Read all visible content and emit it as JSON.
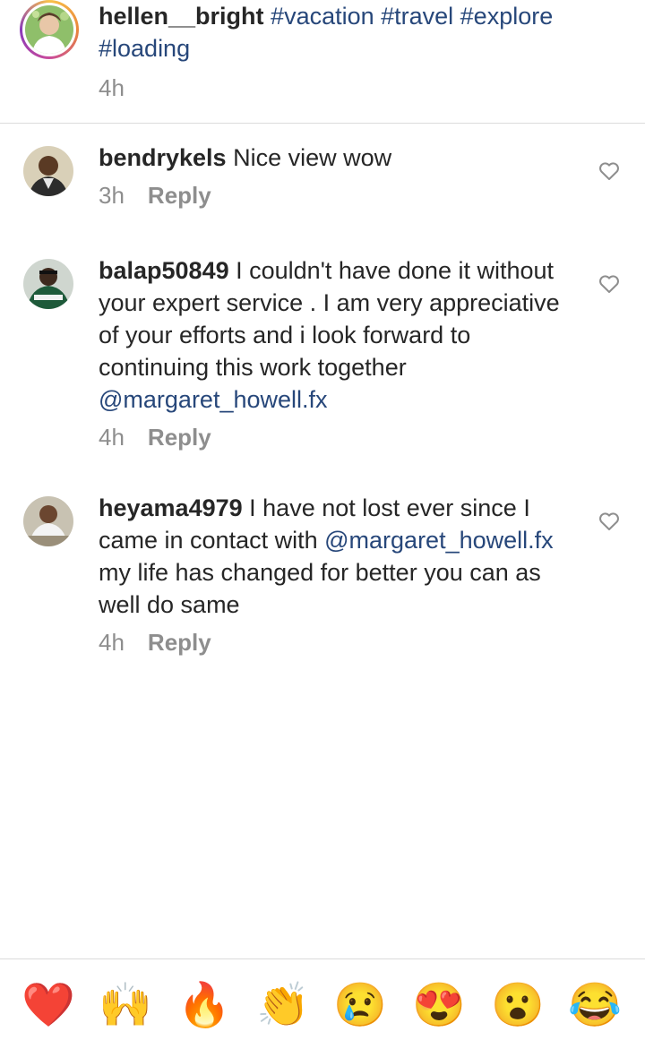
{
  "caption": {
    "username": "hellen__bright",
    "hashtags": "#vacation #travel #explore #loading",
    "time": "4h"
  },
  "comments": [
    {
      "username": "bendrykels",
      "text": "Nice view wow",
      "time": "3h",
      "reply_label": "Reply"
    },
    {
      "username": "balap50849",
      "text": "I couldn't have done it without your expert service . I am very appreciative of your efforts and i look forward to continuing this work together",
      "mention": "@margaret_howell.fx",
      "time": "4h",
      "reply_label": "Reply"
    },
    {
      "username": "heyama4979",
      "text_before": "I have not lost ever since I came in contact with",
      "mention": "@margaret_howell.fx",
      "text_after": "my life has changed for better you can as well do same",
      "time": "4h",
      "reply_label": "Reply"
    }
  ],
  "reactions": [
    "❤️",
    "🙌",
    "🔥",
    "👏",
    "😢",
    "😍",
    "😮",
    "😂"
  ],
  "colors": {
    "link": "#27477a",
    "muted": "#8e8e8e",
    "text": "#262626"
  }
}
